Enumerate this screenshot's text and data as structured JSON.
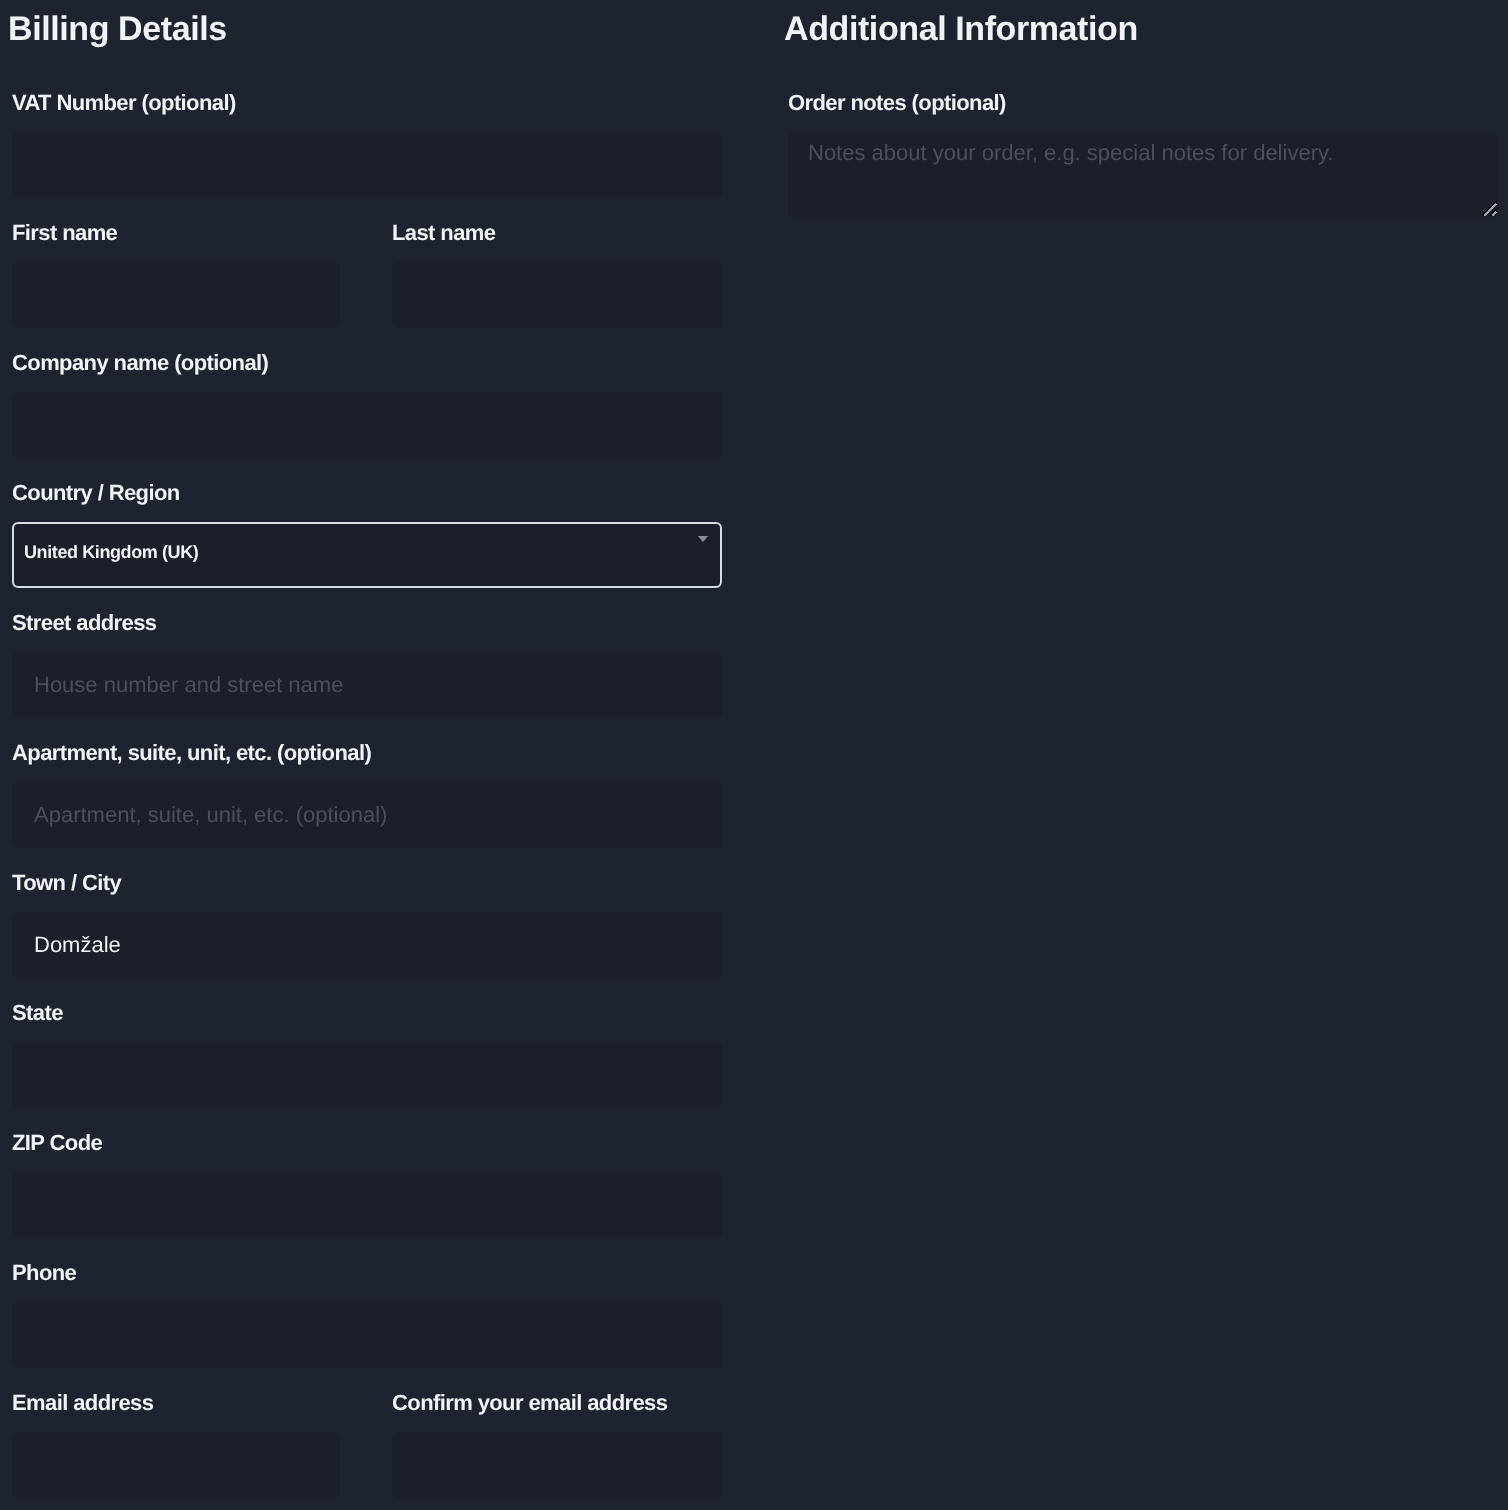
{
  "billing": {
    "title": "Billing Details",
    "rows": [
      {
        "fields": [
          {
            "label": "VAT Number (optional)",
            "kind": "text"
          }
        ]
      },
      {
        "fields": [
          {
            "label": "First name",
            "kind": "text"
          },
          {
            "label": "Last name",
            "kind": "text"
          }
        ]
      },
      {
        "fields": [
          {
            "label": "Company name (optional)",
            "kind": "text"
          }
        ]
      },
      {
        "fields": [
          {
            "label": "Country / Region",
            "kind": "select",
            "value": "United Kingdom (UK)"
          }
        ]
      },
      {
        "fields": [
          {
            "label": "Street address",
            "kind": "text",
            "placeholder": "House number and street name"
          }
        ]
      },
      {
        "fields": [
          {
            "label": "Apartment, suite, unit, etc. (optional)",
            "kind": "text",
            "placeholder": "Apartment, suite, unit, etc. (optional)"
          }
        ]
      },
      {
        "fields": [
          {
            "label": "Town / City",
            "kind": "text",
            "value": "Domžale"
          }
        ]
      },
      {
        "fields": [
          {
            "label": "State",
            "kind": "text"
          }
        ]
      },
      {
        "fields": [
          {
            "label": "ZIP Code",
            "kind": "text"
          }
        ]
      },
      {
        "fields": [
          {
            "label": "Phone",
            "kind": "text"
          }
        ]
      },
      {
        "fields": [
          {
            "label": "Email address",
            "kind": "text"
          },
          {
            "label": "Confirm your email address",
            "kind": "text"
          }
        ]
      }
    ]
  },
  "additional": {
    "title": "Additional Information",
    "fields": [
      {
        "label": "Order notes (optional)",
        "kind": "textarea",
        "placeholder": "Notes about your order, e.g. special notes for delivery."
      }
    ]
  }
}
